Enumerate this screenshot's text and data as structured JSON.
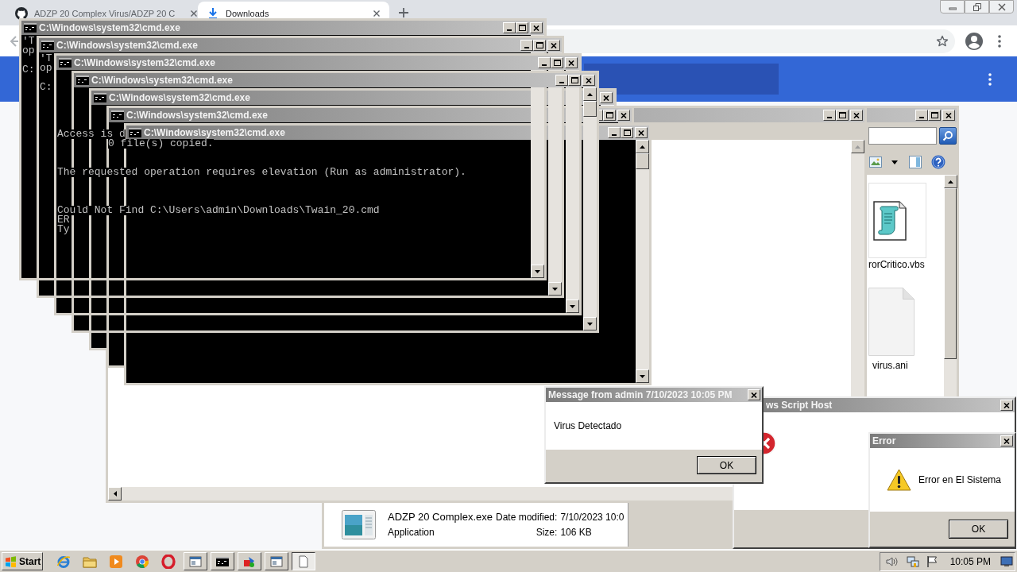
{
  "browser": {
    "tabs": [
      {
        "kind": "page",
        "title": "ADZP 20 Complex Virus/ADZP 20 C",
        "selected": false
      },
      {
        "kind": "downloads",
        "title": "Downloads",
        "selected": true
      }
    ]
  },
  "cmd_windows": [
    {
      "title": "C:\\Windows\\system32\\cmd.exe",
      "output": [
        {
          "kind": "text",
          "text": "'T"
        },
        {
          "kind": "text",
          "text": "op"
        },
        {
          "kind": "blank"
        },
        {
          "kind": "text",
          "text": "C:"
        }
      ]
    },
    {
      "title": "C:\\Windows\\system32\\cmd.exe",
      "output": [
        {
          "kind": "text",
          "text": "'T"
        },
        {
          "kind": "text",
          "text": "op"
        },
        {
          "kind": "blank"
        },
        {
          "kind": "text",
          "text": "C:"
        }
      ]
    },
    {
      "title": "C:\\Windows\\system32\\cmd.exe",
      "output": [
        {
          "kind": "text",
          "text": "Access is d"
        },
        {
          "kind": "indented",
          "text": "0 file(s) copied."
        },
        {
          "kind": "blank"
        },
        {
          "kind": "blank"
        },
        {
          "kind": "text",
          "text": "The requested operation requires elevation (Run as administrator)."
        },
        {
          "kind": "blank"
        },
        {
          "kind": "blank"
        },
        {
          "kind": "blank"
        },
        {
          "kind": "text",
          "text": "Could Not Find C:\\Users\\admin\\Downloads\\Twain_20.cmd"
        },
        {
          "kind": "text",
          "text": "ER"
        },
        {
          "kind": "text",
          "text": "Ty"
        }
      ]
    },
    {
      "title": "C:\\Windows\\system32\\cmd.exe"
    },
    {
      "title": "C:\\Windows\\system32\\cmd.exe"
    },
    {
      "title": "C:\\Windows\\system32\\cmd.exe"
    },
    {
      "title": "C:\\Windows\\system32\\cmd.exe"
    }
  ],
  "explorer": {
    "files": [
      {
        "kind": "script",
        "name": "rorCritico.vbs"
      },
      {
        "kind": "blank",
        "name": "virus.ani"
      }
    ],
    "details": {
      "name": "ADZP 20 Complex.exe",
      "type": "Application",
      "fields": [
        {
          "label": "Date modified:",
          "value": "7/10/2023 10:0"
        },
        {
          "label": "Size:",
          "value": "106 KB"
        }
      ]
    }
  },
  "message_box": {
    "title": "Message from admin 7/10/2023 10:05 PM",
    "text": "Virus Detectado",
    "button": "OK"
  },
  "script_host_dialog": {
    "title": "ws Script Host"
  },
  "error_dialog": {
    "title": "Error",
    "text": "Error en El Sistema",
    "button": "OK"
  },
  "taskbar": {
    "start": "Start",
    "tasks": [
      {
        "kind": "window",
        "selected": false
      },
      {
        "kind": "console",
        "selected": false
      },
      {
        "kind": "paint",
        "selected": false
      },
      {
        "kind": "window",
        "selected": false
      },
      {
        "kind": "document",
        "selected": true
      }
    ],
    "clock": "10:05 PM"
  }
}
